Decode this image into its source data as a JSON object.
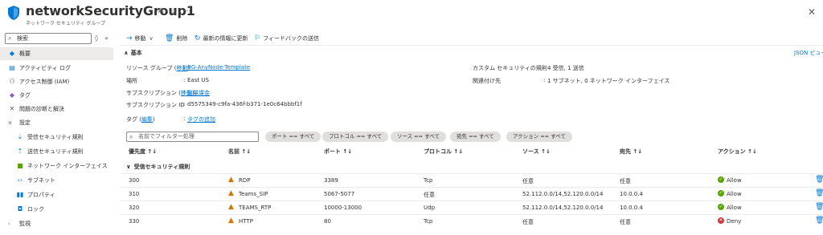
{
  "header": {
    "title": "networkSecurityGroup1",
    "subtitle": "ネットワーク セキュリティ グループ"
  },
  "colors": {
    "accent": "#0078d4",
    "warning": "#d47500",
    "allow": "#57a300",
    "deny": "#d13438"
  },
  "sidebar": {
    "search_placeholder": "検索",
    "items": [
      {
        "label": "概要",
        "icon": "overview-icon"
      },
      {
        "label": "アクティビティ ログ",
        "icon": "activity-log-icon"
      },
      {
        "label": "アクセス制御 (IAM)",
        "icon": "iam-icon"
      },
      {
        "label": "タグ",
        "icon": "tag-icon"
      },
      {
        "label": "問題の診断と解決",
        "icon": "diagnose-icon"
      },
      {
        "label": "設定",
        "icon": "chevron-down-icon"
      },
      {
        "label": "受信セキュリティ規則",
        "icon": "inbound-rules-icon"
      },
      {
        "label": "送信セキュリティ規則",
        "icon": "outbound-rules-icon"
      },
      {
        "label": "ネットワーク インターフェイス",
        "icon": "nic-icon"
      },
      {
        "label": "サブネット",
        "icon": "subnet-icon"
      },
      {
        "label": "プロパティ",
        "icon": "properties-icon"
      },
      {
        "label": "ロック",
        "icon": "lock-icon"
      },
      {
        "label": "監視",
        "icon": "chevron-right-icon"
      }
    ]
  },
  "toolbar": {
    "move": "移動",
    "delete": "削除",
    "refresh": "最新の情報に更新",
    "feedback": "フィードバックの送信"
  },
  "essentials": {
    "heading": "基本",
    "json_view": "JSON ビュー",
    "resource_group_label": "リソース グループ",
    "move_link": "移動",
    "resource_group_value": "RG-AnyNode-Template",
    "location_label": "場所",
    "location_value": "East US",
    "subscription_label": "サブスクリプション",
    "subscription_value": "従量課金",
    "subscription_id_label": "サブスクリプション ID",
    "subscription_id_value": "d5575349-c9fa-436f-b371-1e0c64bbbf1f",
    "tags_label": "タグ",
    "edit_link": "編集",
    "tags_value": "タグの追加",
    "custom_rules_label": "カスタム セキュリティの規則",
    "custom_rules_value": "4 受信, 1 送信",
    "associated_label": "関連付け先",
    "associated_value": "1 サブネット, 0 ネットワーク インターフェイス"
  },
  "filter": {
    "placeholder": "名前でフィルター処理",
    "pills": [
      "ポート == すべて",
      "プロトコル == すべて",
      "ソース == すべて",
      "宛先 == すべて",
      "アクション == すべて"
    ]
  },
  "table": {
    "headers": [
      "優先度 ↑↓",
      "名前 ↑↓",
      "ポート ↑↓",
      "プロトコル ↑↓",
      "ソース ↑↓",
      "宛先 ↑↓",
      "アクション ↑↓"
    ],
    "group": "受信セキュリティ規則",
    "rows": [
      {
        "priority": "300",
        "name": "RDP",
        "port": "3389",
        "protocol": "Tcp",
        "source": "任意",
        "destination": "任意",
        "action": "Allow"
      },
      {
        "priority": "310",
        "name": "Teams_SIP",
        "port": "5067-5077",
        "protocol": "任意",
        "source": "52.112.0.0/14,52.120.0.0/14",
        "destination": "10.0.0.4",
        "action": "Allow"
      },
      {
        "priority": "320",
        "name": "TEAMS_RTP",
        "port": "10000-13000",
        "protocol": "Udp",
        "source": "52.112.0.0/14,52.120.0.0/14",
        "destination": "10.0.0.4",
        "action": "Allow"
      },
      {
        "priority": "330",
        "name": "HTTP",
        "port": "80",
        "protocol": "Tcp",
        "source": "任意",
        "destination": "任意",
        "action": "Deny"
      }
    ]
  }
}
